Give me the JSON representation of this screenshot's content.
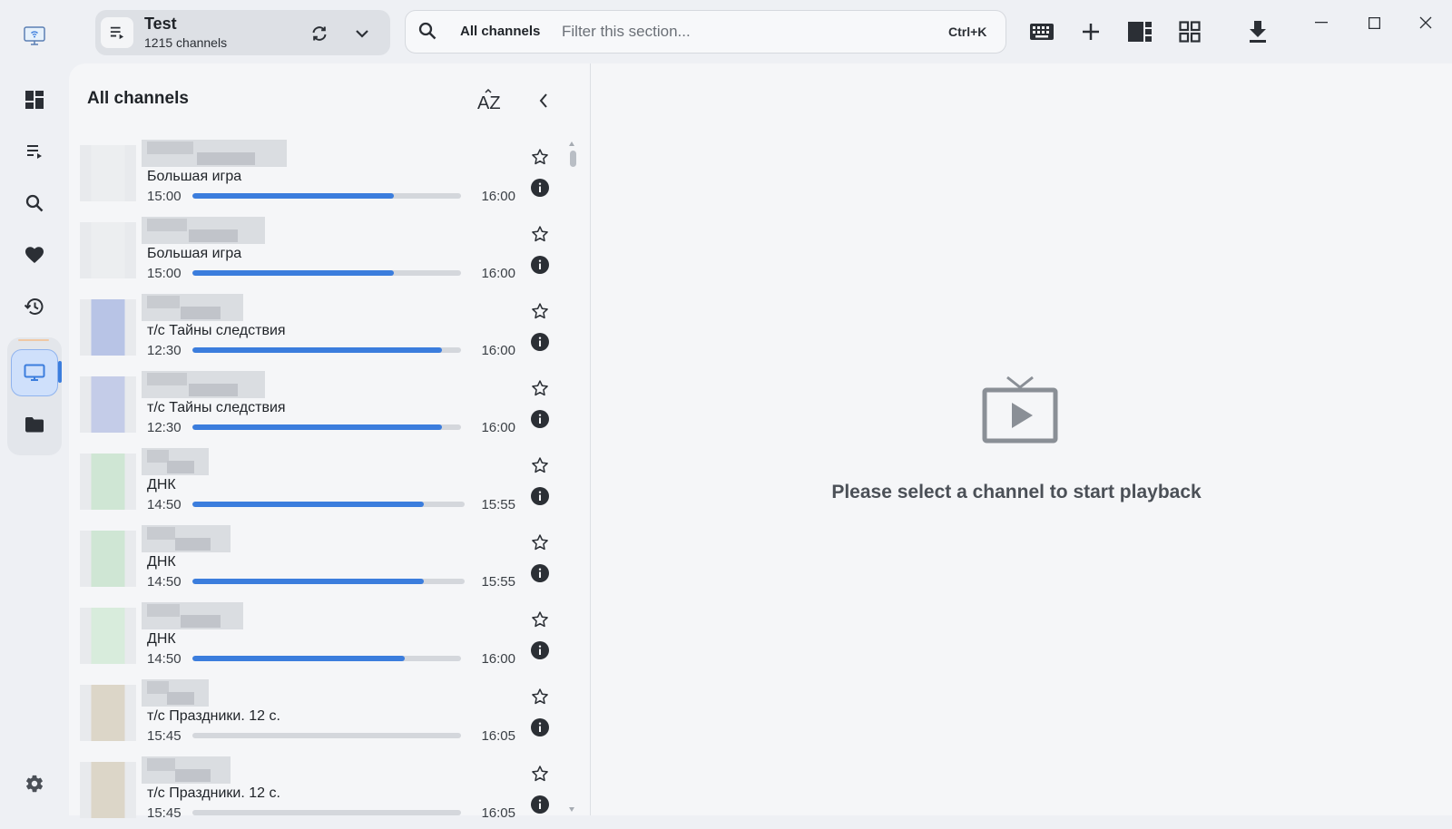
{
  "playlist": {
    "title": "Test",
    "count": "1215 channels"
  },
  "search": {
    "scope": "All channels",
    "placeholder": "Filter this section...",
    "shortcut": "Ctrl+K"
  },
  "list": {
    "title": "All channels",
    "sort_label": "AZ"
  },
  "channels": [
    {
      "program": "Большая игра",
      "start": "15:00",
      "end": "16:00",
      "progress": 0.75,
      "name_blur_width": 160,
      "logo_color": "#eceef0"
    },
    {
      "program": "Большая игра",
      "start": "15:00",
      "end": "16:00",
      "progress": 0.75,
      "name_blur_width": 136,
      "logo_color": "#eceef0"
    },
    {
      "program": "т/с Тайны следствия",
      "start": "12:30",
      "end": "16:00",
      "progress": 0.93,
      "name_blur_width": 112,
      "logo_color": "#b8c4e6"
    },
    {
      "program": "т/с Тайны следствия",
      "start": "12:30",
      "end": "16:00",
      "progress": 0.93,
      "name_blur_width": 136,
      "logo_color": "#c4cce8"
    },
    {
      "program": "ДНК",
      "start": "14:50",
      "end": "15:55",
      "progress": 0.85,
      "name_blur_width": 74,
      "logo_color": "#cfe6d4"
    },
    {
      "program": "ДНК",
      "start": "14:50",
      "end": "15:55",
      "progress": 0.85,
      "name_blur_width": 98,
      "logo_color": "#cfe6d4"
    },
    {
      "program": "ДНК",
      "start": "14:50",
      "end": "16:00",
      "progress": 0.79,
      "name_blur_width": 112,
      "logo_color": "#d8ecdc"
    },
    {
      "program": "т/с Праздники. 12 с.",
      "start": "15:45",
      "end": "16:05",
      "progress": 0.0,
      "name_blur_width": 74,
      "logo_color": "#dcd6c8"
    },
    {
      "program": "т/с Праздники. 12 с.",
      "start": "15:45",
      "end": "16:05",
      "progress": 0.0,
      "name_blur_width": 98,
      "logo_color": "#dcd6c8"
    }
  ],
  "empty_state": {
    "message": "Please select a channel to start playback"
  },
  "colors": {
    "accent": "#3b7ddd",
    "active_rail": "#cfe0fb"
  },
  "rail_icons": [
    "app-logo-icon",
    "dashboard-icon",
    "playlist-icon",
    "search-icon",
    "favorites-icon",
    "history-icon",
    "tv-icon",
    "folder-icon",
    "gear-icon"
  ]
}
